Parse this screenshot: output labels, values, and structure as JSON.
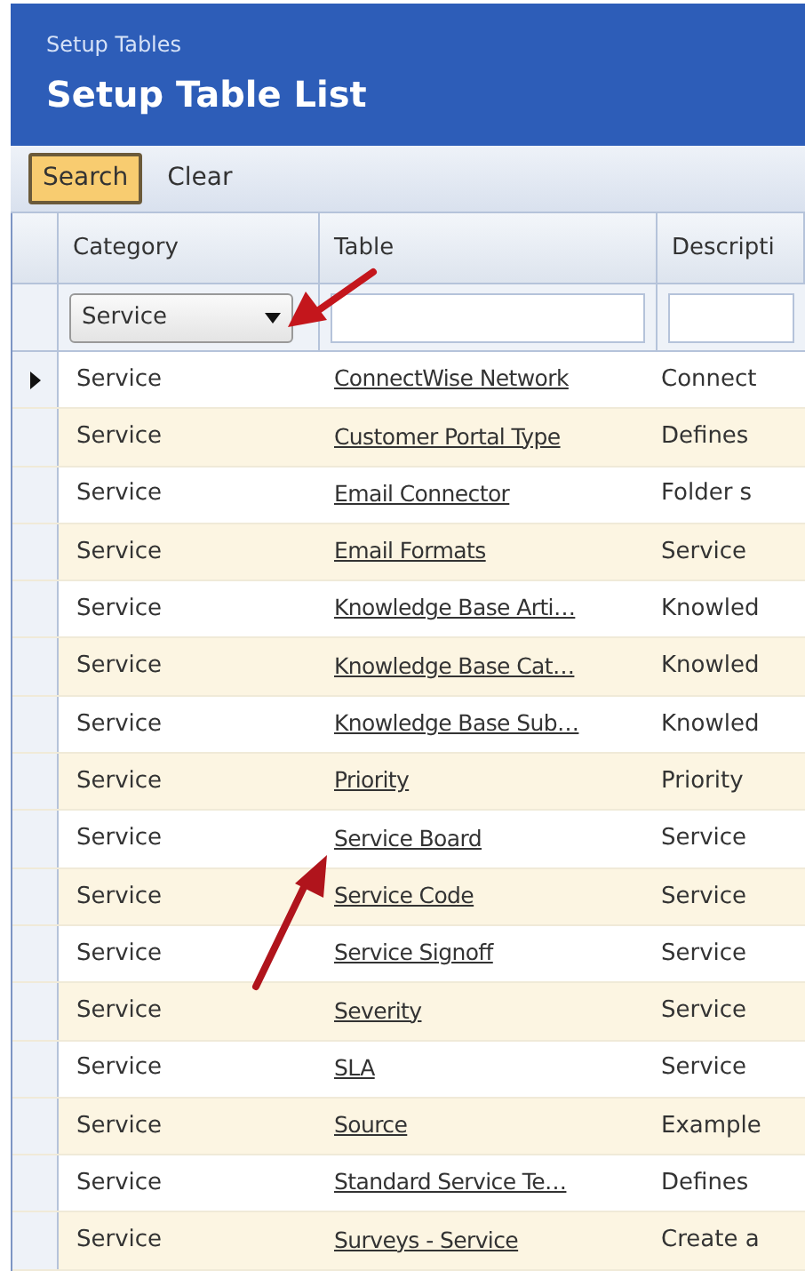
{
  "window": {
    "title": "Setup Tables",
    "heading": "Setup Table List"
  },
  "toolbar": [
    {
      "label": "Search",
      "selected": true
    },
    {
      "label": "Clear",
      "selected": false
    }
  ],
  "table": {
    "columns": [
      "Category",
      "Table",
      "Descripti"
    ],
    "filters": {
      "category": "Service"
    },
    "rows": [
      {
        "selected": true,
        "category": "Service",
        "table": "ConnectWise Network",
        "description": "Connect"
      },
      {
        "selected": false,
        "category": "Service",
        "table": "Customer Portal Type",
        "description": "Defines"
      },
      {
        "selected": false,
        "category": "Service",
        "table": "Email Connector",
        "description": "Folder s"
      },
      {
        "selected": false,
        "category": "Service",
        "table": "Email Formats",
        "description": "Service"
      },
      {
        "selected": false,
        "category": "Service",
        "table": "Knowledge Base Arti…",
        "description": "Knowled"
      },
      {
        "selected": false,
        "category": "Service",
        "table": "Knowledge Base Cat…",
        "description": "Knowled"
      },
      {
        "selected": false,
        "category": "Service",
        "table": "Knowledge Base Sub…",
        "description": "Knowled"
      },
      {
        "selected": false,
        "category": "Service",
        "table": "Priority",
        "description": "Priority"
      },
      {
        "selected": false,
        "category": "Service",
        "table": "Service Board",
        "description": "Service"
      },
      {
        "selected": false,
        "category": "Service",
        "table": "Service Code",
        "description": "Service"
      },
      {
        "selected": false,
        "category": "Service",
        "table": "Service Signoff",
        "description": "Service"
      },
      {
        "selected": false,
        "category": "Service",
        "table": "Severity",
        "description": "Service"
      },
      {
        "selected": false,
        "category": "Service",
        "table": "SLA",
        "description": "Service"
      },
      {
        "selected": false,
        "category": "Service",
        "table": "Source",
        "description": "Example"
      },
      {
        "selected": false,
        "category": "Service",
        "table": "Standard Service Te…",
        "description": "Defines"
      },
      {
        "selected": false,
        "category": "Service",
        "table": "Surveys - Service",
        "description": "Create a"
      }
    ]
  }
}
